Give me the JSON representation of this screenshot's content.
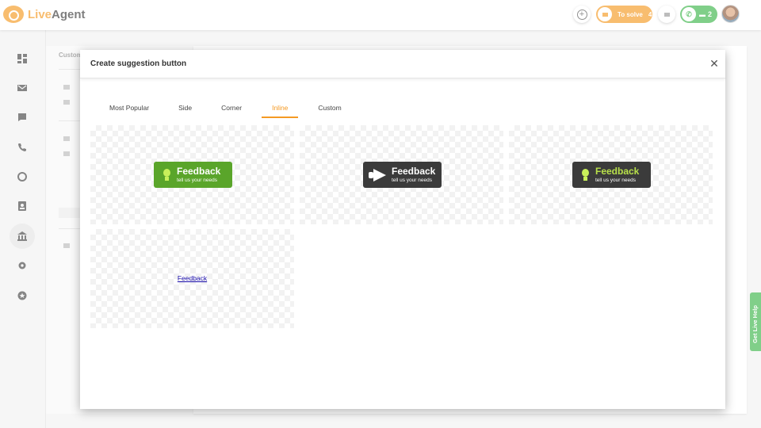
{
  "app": {
    "logo_prefix": "Live",
    "logo_suffix": "Agent"
  },
  "topbar": {
    "to_solve_label": "To solve",
    "to_solve_count": "4",
    "calls_count": "2",
    "accent_orange": "#f59a23",
    "accent_green": "#3cb54a"
  },
  "nav": {
    "items": [
      "dashboard-icon",
      "tickets-icon",
      "chats-icon",
      "calls-icon",
      "reports-icon",
      "contacts-icon",
      "knowledgebase-icon",
      "settings-icon",
      "plugins-icon"
    ],
    "active": "knowledgebase-icon"
  },
  "background_panel": {
    "header": "Custom"
  },
  "help_tab": {
    "label": "Get Live Help"
  },
  "modal": {
    "title": "Create suggestion button",
    "close_icon": "close-icon",
    "tabs": [
      {
        "label": "Most Popular"
      },
      {
        "label": "Side"
      },
      {
        "label": "Corner"
      },
      {
        "label": "Inline"
      },
      {
        "label": "Custom"
      }
    ],
    "active_tab": "Inline",
    "previews": [
      {
        "style": "green",
        "title": "Feedback",
        "subtitle": "tell us your needs",
        "icon": "lightbulb-icon"
      },
      {
        "style": "dark",
        "title": "Feedback",
        "subtitle": "tell us your needs",
        "icon": "megaphone-icon"
      },
      {
        "style": "dark-lime",
        "title": "Feedback",
        "subtitle": "tell us your needs",
        "icon": "lightbulb-icon"
      },
      {
        "style": "link",
        "title": "Feedback"
      }
    ]
  }
}
